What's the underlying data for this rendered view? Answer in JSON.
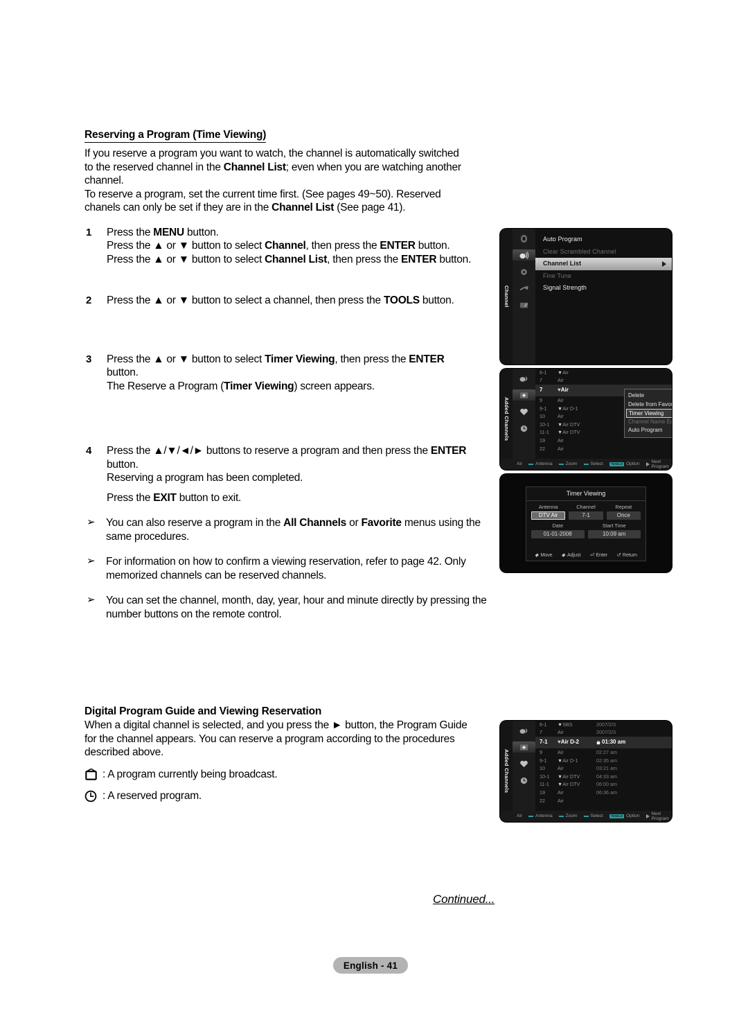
{
  "section1": {
    "heading": "Reserving a Program (Time Viewing)",
    "intro_lines": [
      "If you reserve a program you want to watch, the channel is automatically switched",
      "to the reserved channel in the Channel List; even when you are watching another",
      "channel.",
      "To reserve a program, set the current time first. (See pages 49~50). Reserved",
      "chanels can only be set if they are in the Channel List (See page 41)."
    ],
    "steps": [
      {
        "num": "1",
        "lines": [
          "Press the MENU button.",
          "Press the ▲ or ▼ button to select Channel, then press the ENTER button.",
          "Press the ▲ or ▼ button to select Channel List, then press the ENTER button."
        ]
      },
      {
        "num": "2",
        "lines": [
          "Press the ▲ or ▼ button to select a channel, then press the TOOLS button."
        ]
      },
      {
        "num": "3",
        "lines": [
          "Press the ▲ or ▼ button to select Timer Viewing, then press the ENTER",
          "button.",
          "The Reserve a Program (Timer Viewing) screen appears."
        ]
      },
      {
        "num": "4",
        "lines": [
          "Press the ▲/▼/◄/► buttons to reserve a program and then press the ENTER",
          "button.",
          "Reserving a program has been completed.",
          "Press the EXIT button to exit."
        ]
      }
    ],
    "bullets": [
      {
        "mark": "➢",
        "lines": [
          "You can also reserve a program in the All Channels or Favorite menus",
          "using the same procedures."
        ]
      },
      {
        "mark": "➢",
        "lines": [
          "For information on how to confirm a viewing reservation, refer to page 42.",
          "Only memorized channels can be reserved channels."
        ]
      },
      {
        "mark": "➢",
        "lines": [
          "You can set the channel, month, day, year, hour and minute directly by",
          "pressing the number buttons on the remote control."
        ]
      }
    ]
  },
  "section2": {
    "heading": "Digital Program Guide and Viewing Reservation",
    "lines": [
      "When a digital channel is selected, and you press the ► button, the Program Guide",
      "for the channel appears. You can reserve a program according to the procedures",
      "described above."
    ],
    "legend": [
      {
        "icon": "tv-icon",
        "text": ": A program currently being broadcast."
      },
      {
        "icon": "clock-icon",
        "text": ": A reserved program."
      }
    ]
  },
  "footer": {
    "continued": "Continued...",
    "page_badge": "English - 41"
  },
  "osd_menu": {
    "tab_label": "Channel",
    "rail_icons": [
      "picture-icon",
      "channel-icon",
      "setup-icon",
      "input-icon",
      "support-icon"
    ],
    "items": [
      {
        "label": "Auto Program",
        "state": "normal"
      },
      {
        "label": "Clear Scrambled Channel",
        "state": "dim"
      },
      {
        "label": "Channel List",
        "state": "highlight"
      },
      {
        "label": "Fine Tune",
        "state": "dim"
      },
      {
        "label": "Signal Strength",
        "state": "normal"
      }
    ]
  },
  "osd_list": {
    "tab_label": "Added Channels",
    "rail_icons": [
      "antenna-icon",
      "added-channels-icon",
      "favorite-icon",
      "reserved-icon"
    ],
    "rows": [
      {
        "num": "6-1",
        "heart": "▼",
        "name": "Air",
        "sel": false
      },
      {
        "num": "7",
        "heart": "",
        "name": "Air",
        "sel": false
      },
      {
        "num": "7",
        "heart": "♥",
        "name": "Air",
        "sel": true
      },
      {
        "num": "9",
        "heart": "",
        "name": "Air",
        "sel": false
      },
      {
        "num": "9-1",
        "heart": "▼",
        "name": "Air D-1",
        "sel": false
      },
      {
        "num": "10",
        "heart": "",
        "name": "Air",
        "sel": false
      },
      {
        "num": "10-1",
        "heart": "▼",
        "name": "Air DTV",
        "sel": false
      },
      {
        "num": "11-1",
        "heart": "▼",
        "name": "Air DTV",
        "sel": false
      },
      {
        "num": "19",
        "heart": "",
        "name": "Air",
        "sel": false
      },
      {
        "num": "22",
        "heart": "",
        "name": "Air",
        "sel": false
      }
    ],
    "popup": [
      {
        "label": "Delete",
        "state": "normal"
      },
      {
        "label": "Delete from Favorite",
        "state": "normal"
      },
      {
        "label": "Timer Viewing",
        "state": "selected"
      },
      {
        "label": "Channel Name Edit",
        "state": "dim"
      },
      {
        "label": "Auto Program",
        "state": "normal"
      }
    ],
    "statusbar": {
      "source": "Air",
      "items": [
        "Antenna",
        "Zoom",
        "Select"
      ],
      "tools_label": "TOOLS",
      "option_label": "Option",
      "next_label": "Next Program"
    }
  },
  "osd_timer": {
    "title": "Timer Viewing",
    "fields": [
      {
        "label": "Antenna",
        "value": "DTV Air",
        "selected": true
      },
      {
        "label": "Channel",
        "value": "7-1",
        "selected": false
      },
      {
        "label": "Repeat",
        "value": "Once",
        "selected": false
      }
    ],
    "fields2": [
      {
        "label": "Date",
        "value": "01-01-2008",
        "selected": false
      },
      {
        "label": "Start Time",
        "value": "10:09 am",
        "selected": false
      }
    ],
    "footer": [
      {
        "icon": "move-icon",
        "label": "Move"
      },
      {
        "icon": "adjust-icon",
        "label": "Adjust"
      },
      {
        "icon": "enter-icon",
        "label": "Enter"
      },
      {
        "icon": "return-icon",
        "label": "Return"
      }
    ]
  },
  "osd_guide": {
    "tab_label": "Added Channels",
    "rail_icons": [
      "antenna-icon",
      "added-channels-icon",
      "favorite-icon",
      "reserved-icon"
    ],
    "rows": [
      {
        "num": "6-1",
        "heart": "▼",
        "name": "SBS",
        "time": "2007/2/3",
        "tv": false,
        "sel": false
      },
      {
        "num": "7",
        "heart": "",
        "name": "Air",
        "time": "2007/2/3",
        "tv": false,
        "sel": false
      },
      {
        "num": "7-1",
        "heart": "♥",
        "name": "Air D-2",
        "time": "01:30  am",
        "tv": true,
        "sel": true
      },
      {
        "num": "9",
        "heart": "",
        "name": "Air",
        "time": "02:27  am",
        "tv": false,
        "sel": false
      },
      {
        "num": "9-1",
        "heart": "▼",
        "name": "Air D-1",
        "time": "02:35  am",
        "tv": false,
        "sel": false
      },
      {
        "num": "10",
        "heart": "",
        "name": "Air",
        "time": "03:21  am",
        "tv": false,
        "sel": false
      },
      {
        "num": "10-1",
        "heart": "▼",
        "name": "Air DTV",
        "time": "04:33  am",
        "tv": false,
        "sel": false
      },
      {
        "num": "11-1",
        "heart": "▼",
        "name": "Air DTV",
        "time": "06:00  am",
        "tv": false,
        "sel": false
      },
      {
        "num": "19",
        "heart": "",
        "name": "Air",
        "time": "06:36  am",
        "tv": false,
        "sel": false
      },
      {
        "num": "22",
        "heart": "",
        "name": "Air",
        "time": "",
        "tv": false,
        "sel": false
      }
    ],
    "statusbar": {
      "source": "Air",
      "items": [
        "Antenna",
        "Zoom",
        "Select"
      ],
      "tools_label": "TOOLS",
      "option_label": "Option",
      "next_label": "Next Program"
    }
  }
}
